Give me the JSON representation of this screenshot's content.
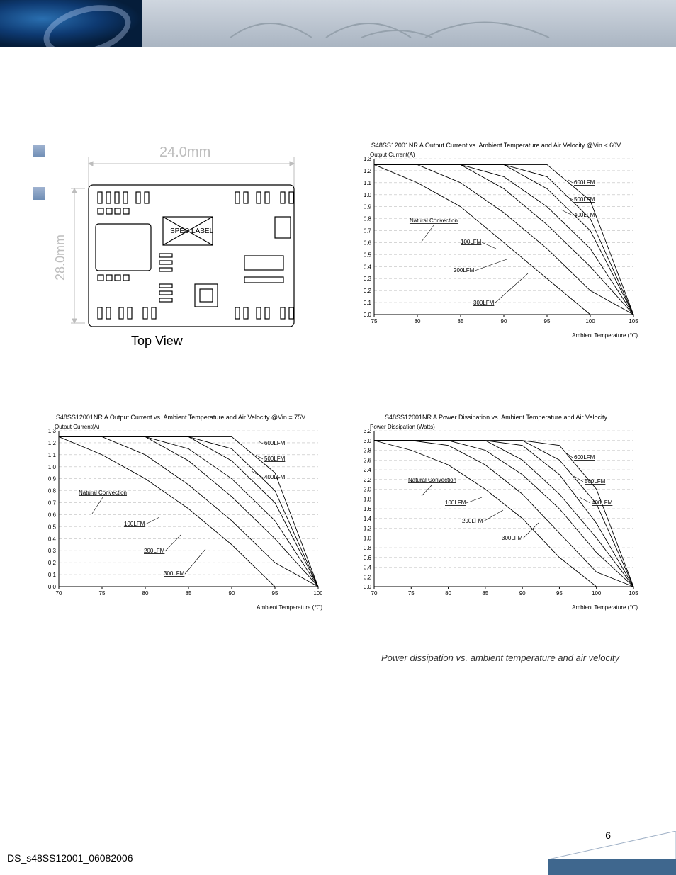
{
  "pcb": {
    "width_label": "24.0mm",
    "height_label": "28.0mm",
    "spec_label": "SPEC LABEL",
    "view_label": "Top View"
  },
  "charts": {
    "top_right": {
      "title": "S48SS12001NR A Output Current vs. Ambient Temperature and Air Velocity @Vin < 60V",
      "ylabel": "Output Current(A)",
      "xlabel": "Ambient Temperature (℃)",
      "x_ticks": [
        "75",
        "80",
        "85",
        "90",
        "95",
        "100",
        "105"
      ],
      "y_ticks": [
        "0.0",
        "0.1",
        "0.2",
        "0.3",
        "0.4",
        "0.5",
        "0.6",
        "0.7",
        "0.8",
        "0.9",
        "1.0",
        "1.1",
        "1.2",
        "1.3"
      ],
      "annotations": [
        "Natural Convection",
        "100LFM",
        "200LFM",
        "300LFM",
        "400LFM",
        "500LFM",
        "600LFM"
      ]
    },
    "bottom_left": {
      "title": "S48SS12001NR A Output Current vs. Ambient Temperature and Air Velocity @Vin = 75V",
      "ylabel": "Output Current(A)",
      "xlabel": "Ambient Temperature (℃)",
      "x_ticks": [
        "70",
        "75",
        "80",
        "85",
        "90",
        "95",
        "100"
      ],
      "y_ticks": [
        "0.0",
        "0.1",
        "0.2",
        "0.3",
        "0.4",
        "0.5",
        "0.6",
        "0.7",
        "0.8",
        "0.9",
        "1.0",
        "1.1",
        "1.2",
        "1.3"
      ],
      "annotations": [
        "Natural Convection",
        "100LFM",
        "200LFM",
        "300LFM",
        "400LFM",
        "500LFM",
        "600LFM"
      ]
    },
    "bottom_right": {
      "title": "S48SS12001NR A Power Dissipation vs. Ambient Temperature and Air Velocity",
      "ylabel": "Power Dissipation (Watts)",
      "xlabel": "Ambient Temperature (℃)",
      "x_ticks": [
        "70",
        "75",
        "80",
        "85",
        "90",
        "95",
        "100",
        "105"
      ],
      "y_ticks": [
        "0.0",
        "0.2",
        "0.4",
        "0.6",
        "0.8",
        "1.0",
        "1.2",
        "1.4",
        "1.6",
        "1.8",
        "2.0",
        "2.2",
        "2.4",
        "2.6",
        "2.8",
        "3.0",
        "3.2"
      ],
      "annotations": [
        "Natural Convection",
        "100LFM",
        "200LFM",
        "300LFM",
        "400LFM",
        "500LFM",
        "600LFM"
      ]
    }
  },
  "caption": "Power dissipation vs. ambient temperature and air velocity",
  "footer_doc": "DS_s48SS12001_06082006",
  "page_number": "6",
  "chart_data": [
    {
      "type": "line",
      "title": "S48SS12001NR A Output Current vs. Ambient Temperature and Air Velocity @Vin < 60V",
      "xlabel": "Ambient Temperature (℃)",
      "ylabel": "Output Current(A)",
      "xlim": [
        75,
        105
      ],
      "ylim": [
        0,
        1.3
      ],
      "x": [
        75,
        80,
        85,
        90,
        95,
        100,
        105
      ],
      "series": [
        {
          "name": "Natural Convection",
          "values": [
            1.25,
            1.1,
            0.9,
            0.6,
            0.3,
            0.0,
            null
          ]
        },
        {
          "name": "100LFM",
          "values": [
            1.25,
            1.25,
            1.1,
            0.85,
            0.55,
            0.2,
            0.0
          ]
        },
        {
          "name": "200LFM",
          "values": [
            1.25,
            1.25,
            1.25,
            1.05,
            0.75,
            0.4,
            0.0
          ]
        },
        {
          "name": "300LFM",
          "values": [
            1.25,
            1.25,
            1.25,
            1.15,
            0.9,
            0.55,
            0.0
          ]
        },
        {
          "name": "400LFM",
          "values": [
            1.25,
            1.25,
            1.25,
            1.25,
            1.05,
            0.7,
            0.0
          ]
        },
        {
          "name": "500LFM",
          "values": [
            1.25,
            1.25,
            1.25,
            1.25,
            1.15,
            0.8,
            0.0
          ]
        },
        {
          "name": "600LFM",
          "values": [
            1.25,
            1.25,
            1.25,
            1.25,
            1.25,
            0.95,
            0.0
          ]
        }
      ]
    },
    {
      "type": "line",
      "title": "S48SS12001NR A Output Current vs. Ambient Temperature and Air Velocity @Vin = 75V",
      "xlabel": "Ambient Temperature (℃)",
      "ylabel": "Output Current(A)",
      "xlim": [
        70,
        100
      ],
      "ylim": [
        0,
        1.3
      ],
      "x": [
        70,
        75,
        80,
        85,
        90,
        95,
        100
      ],
      "series": [
        {
          "name": "Natural Convection",
          "values": [
            1.25,
            1.1,
            0.9,
            0.65,
            0.35,
            0.0,
            null
          ]
        },
        {
          "name": "100LFM",
          "values": [
            1.25,
            1.25,
            1.1,
            0.85,
            0.55,
            0.2,
            0.0
          ]
        },
        {
          "name": "200LFM",
          "values": [
            1.25,
            1.25,
            1.25,
            1.05,
            0.75,
            0.4,
            0.0
          ]
        },
        {
          "name": "300LFM",
          "values": [
            1.25,
            1.25,
            1.25,
            1.15,
            0.9,
            0.55,
            0.0
          ]
        },
        {
          "name": "400LFM",
          "values": [
            1.25,
            1.25,
            1.25,
            1.25,
            1.05,
            0.7,
            0.0
          ]
        },
        {
          "name": "500LFM",
          "values": [
            1.25,
            1.25,
            1.25,
            1.25,
            1.15,
            0.8,
            0.0
          ]
        },
        {
          "name": "600LFM",
          "values": [
            1.25,
            1.25,
            1.25,
            1.25,
            1.25,
            0.95,
            0.0
          ]
        }
      ]
    },
    {
      "type": "line",
      "title": "S48SS12001NR A Power Dissipation vs. Ambient Temperature and Air Velocity",
      "xlabel": "Ambient Temperature (℃)",
      "ylabel": "Power Dissipation (Watts)",
      "xlim": [
        70,
        105
      ],
      "ylim": [
        0,
        3.2
      ],
      "x": [
        70,
        75,
        80,
        85,
        90,
        95,
        100,
        105
      ],
      "series": [
        {
          "name": "Natural Convection",
          "values": [
            3.0,
            2.8,
            2.5,
            2.0,
            1.4,
            0.6,
            0.0,
            null
          ]
        },
        {
          "name": "100LFM",
          "values": [
            3.0,
            3.0,
            2.9,
            2.5,
            1.9,
            1.1,
            0.3,
            0.0
          ]
        },
        {
          "name": "200LFM",
          "values": [
            3.0,
            3.0,
            3.0,
            2.8,
            2.3,
            1.6,
            0.7,
            0.0
          ]
        },
        {
          "name": "300LFM",
          "values": [
            3.0,
            3.0,
            3.0,
            3.0,
            2.6,
            1.9,
            1.0,
            0.0
          ]
        },
        {
          "name": "400LFM",
          "values": [
            3.0,
            3.0,
            3.0,
            3.0,
            2.9,
            2.3,
            1.3,
            0.0
          ]
        },
        {
          "name": "500LFM",
          "values": [
            3.0,
            3.0,
            3.0,
            3.0,
            3.0,
            2.6,
            1.7,
            0.0
          ]
        },
        {
          "name": "600LFM",
          "values": [
            3.0,
            3.0,
            3.0,
            3.0,
            3.0,
            2.9,
            2.0,
            0.0
          ]
        }
      ]
    }
  ]
}
